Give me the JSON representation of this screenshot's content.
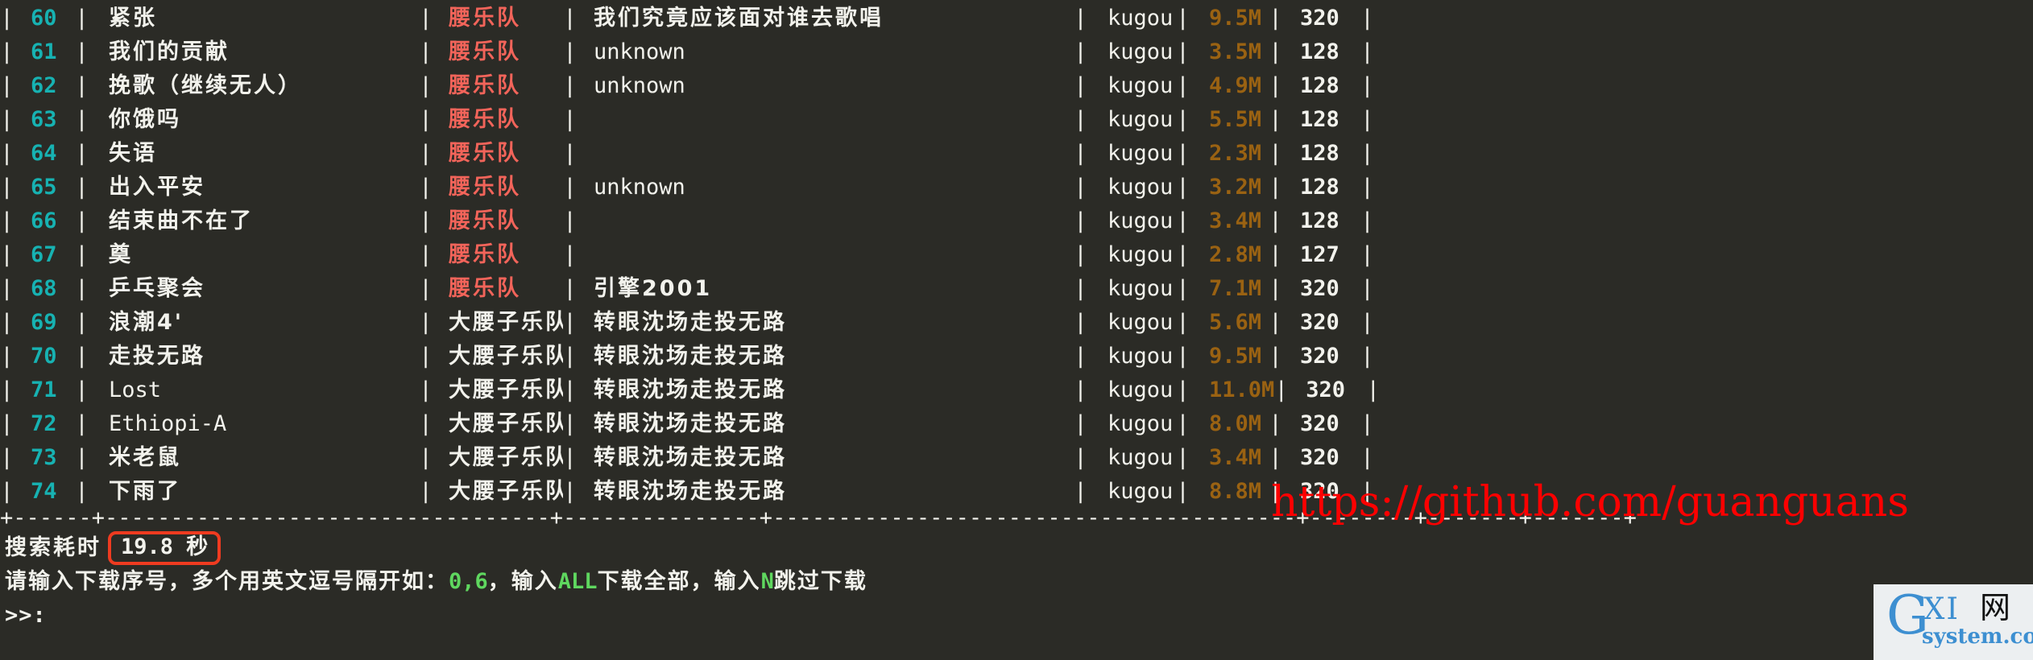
{
  "terminal": {
    "background": "#2b2b26",
    "foreground": "#f2f2ec",
    "index_color": "#17b2b2",
    "highlight_artist_color": "#f2645a",
    "size_color": "#9a6212",
    "keyword_color": "#5fd75f",
    "accent_red": "#ef3b20"
  },
  "table": {
    "separator": "|",
    "rows": [
      {
        "index": "60",
        "title": "紧张",
        "artist": "腰乐队",
        "artist_highlight": true,
        "album": "我们究竟应该面对谁去歌唱",
        "source": "kugou",
        "size": "9.5M",
        "bitrate": "320"
      },
      {
        "index": "61",
        "title": "我们的贡献",
        "artist": "腰乐队",
        "artist_highlight": true,
        "album": "unknown",
        "source": "kugou",
        "size": "3.5M",
        "bitrate": "128"
      },
      {
        "index": "62",
        "title": "挽歌（继续无人）",
        "artist": "腰乐队",
        "artist_highlight": true,
        "album": "unknown",
        "source": "kugou",
        "size": "4.9M",
        "bitrate": "128"
      },
      {
        "index": "63",
        "title": "你饿吗",
        "artist": "腰乐队",
        "artist_highlight": true,
        "album": "",
        "source": "kugou",
        "size": "5.5M",
        "bitrate": "128"
      },
      {
        "index": "64",
        "title": "失语",
        "artist": "腰乐队",
        "artist_highlight": true,
        "album": "",
        "source": "kugou",
        "size": "2.3M",
        "bitrate": "128"
      },
      {
        "index": "65",
        "title": "出入平安",
        "artist": "腰乐队",
        "artist_highlight": true,
        "album": "unknown",
        "source": "kugou",
        "size": "3.2M",
        "bitrate": "128"
      },
      {
        "index": "66",
        "title": "结束曲不在了",
        "artist": "腰乐队",
        "artist_highlight": true,
        "album": "",
        "source": "kugou",
        "size": "3.4M",
        "bitrate": "128"
      },
      {
        "index": "67",
        "title": "奠",
        "artist": "腰乐队",
        "artist_highlight": true,
        "album": "",
        "source": "kugou",
        "size": "2.8M",
        "bitrate": "127"
      },
      {
        "index": "68",
        "title": "乒乓聚会",
        "artist": "腰乐队",
        "artist_highlight": true,
        "album": "引擎2001",
        "source": "kugou",
        "size": "7.1M",
        "bitrate": "320"
      },
      {
        "index": "69",
        "title": "浪潮4'",
        "artist": "大腰子乐队",
        "artist_highlight": false,
        "album": "转眼沈场走投无路",
        "source": "kugou",
        "size": "5.6M",
        "bitrate": "320"
      },
      {
        "index": "70",
        "title": "走投无路",
        "artist": "大腰子乐队",
        "artist_highlight": false,
        "album": "转眼沈场走投无路",
        "source": "kugou",
        "size": "9.5M",
        "bitrate": "320"
      },
      {
        "index": "71",
        "title": "Lost",
        "artist": "大腰子乐队",
        "artist_highlight": false,
        "album": "转眼沈场走投无路",
        "source": "kugou",
        "size": "11.0M",
        "bitrate": "320"
      },
      {
        "index": "72",
        "title": "Ethiopi-A",
        "artist": "大腰子乐队",
        "artist_highlight": false,
        "album": "转眼沈场走投无路",
        "source": "kugou",
        "size": "8.0M",
        "bitrate": "320"
      },
      {
        "index": "73",
        "title": "米老鼠",
        "artist": "大腰子乐队",
        "artist_highlight": false,
        "album": "转眼沈场走投无路",
        "source": "kugou",
        "size": "3.4M",
        "bitrate": "320"
      },
      {
        "index": "74",
        "title": "下雨了",
        "artist": "大腰子乐队",
        "artist_highlight": false,
        "album": "转眼沈场走投无路",
        "source": "kugou",
        "size": "8.8M",
        "bitrate": "320"
      }
    ],
    "bottom_rule": "+------+----------------------------------+---------------+----------------------------------------+--------+-------+-------+"
  },
  "footer": {
    "elapsed_label": "搜索耗时",
    "elapsed_value": "19.8",
    "elapsed_unit": "秒",
    "hint_part1": "请输入下载序号，多个用英文逗号隔开如：",
    "hint_example": "0,6",
    "hint_part2": "，输入",
    "hint_all": "ALL",
    "hint_part3": "下载全部，输入",
    "hint_skip": "N",
    "hint_part4": "跳过下载",
    "prompt": ">>:"
  },
  "watermarks": {
    "url": "https://github.com/guanguans",
    "logo_g": "G",
    "logo_xi": "XI",
    "logo_wang": "网",
    "logo_domain": "system.com"
  }
}
